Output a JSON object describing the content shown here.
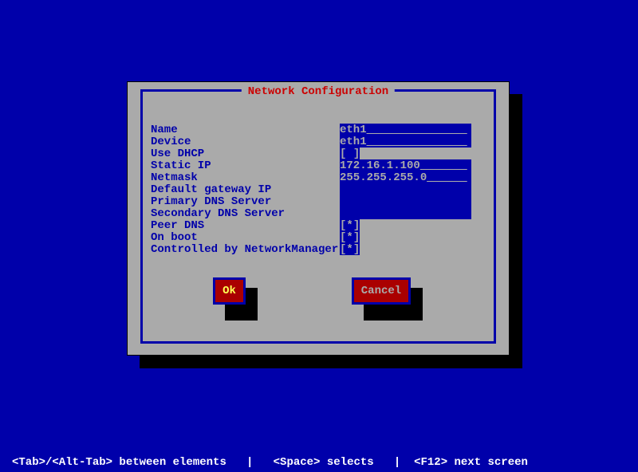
{
  "dialog": {
    "title": "Network Configuration"
  },
  "fields": {
    "name": {
      "label": "Name",
      "value": "eth1"
    },
    "device": {
      "label": "Device",
      "value": "eth1"
    },
    "use_dhcp": {
      "label": "Use DHCP",
      "checked": " "
    },
    "static_ip": {
      "label": "Static IP",
      "value": "172.16.1.100"
    },
    "netmask": {
      "label": "Netmask",
      "value": "255.255.255.0"
    },
    "gateway": {
      "label": "Default gateway IP",
      "value": ""
    },
    "primary_dns": {
      "label": "Primary DNS Server",
      "value": ""
    },
    "secondary_dns": {
      "label": "Secondary DNS Server",
      "value": ""
    },
    "peer_dns": {
      "label": "Peer DNS",
      "checked": "*"
    },
    "on_boot": {
      "label": "On boot",
      "checked": "*"
    },
    "networkmanager": {
      "label": "Controlled by NetworkManager",
      "checked": "*"
    }
  },
  "buttons": {
    "ok": "Ok",
    "cancel": "Cancel"
  },
  "footer": "<Tab>/<Alt-Tab> between elements   |   <Space> selects   |  <F12> next screen"
}
